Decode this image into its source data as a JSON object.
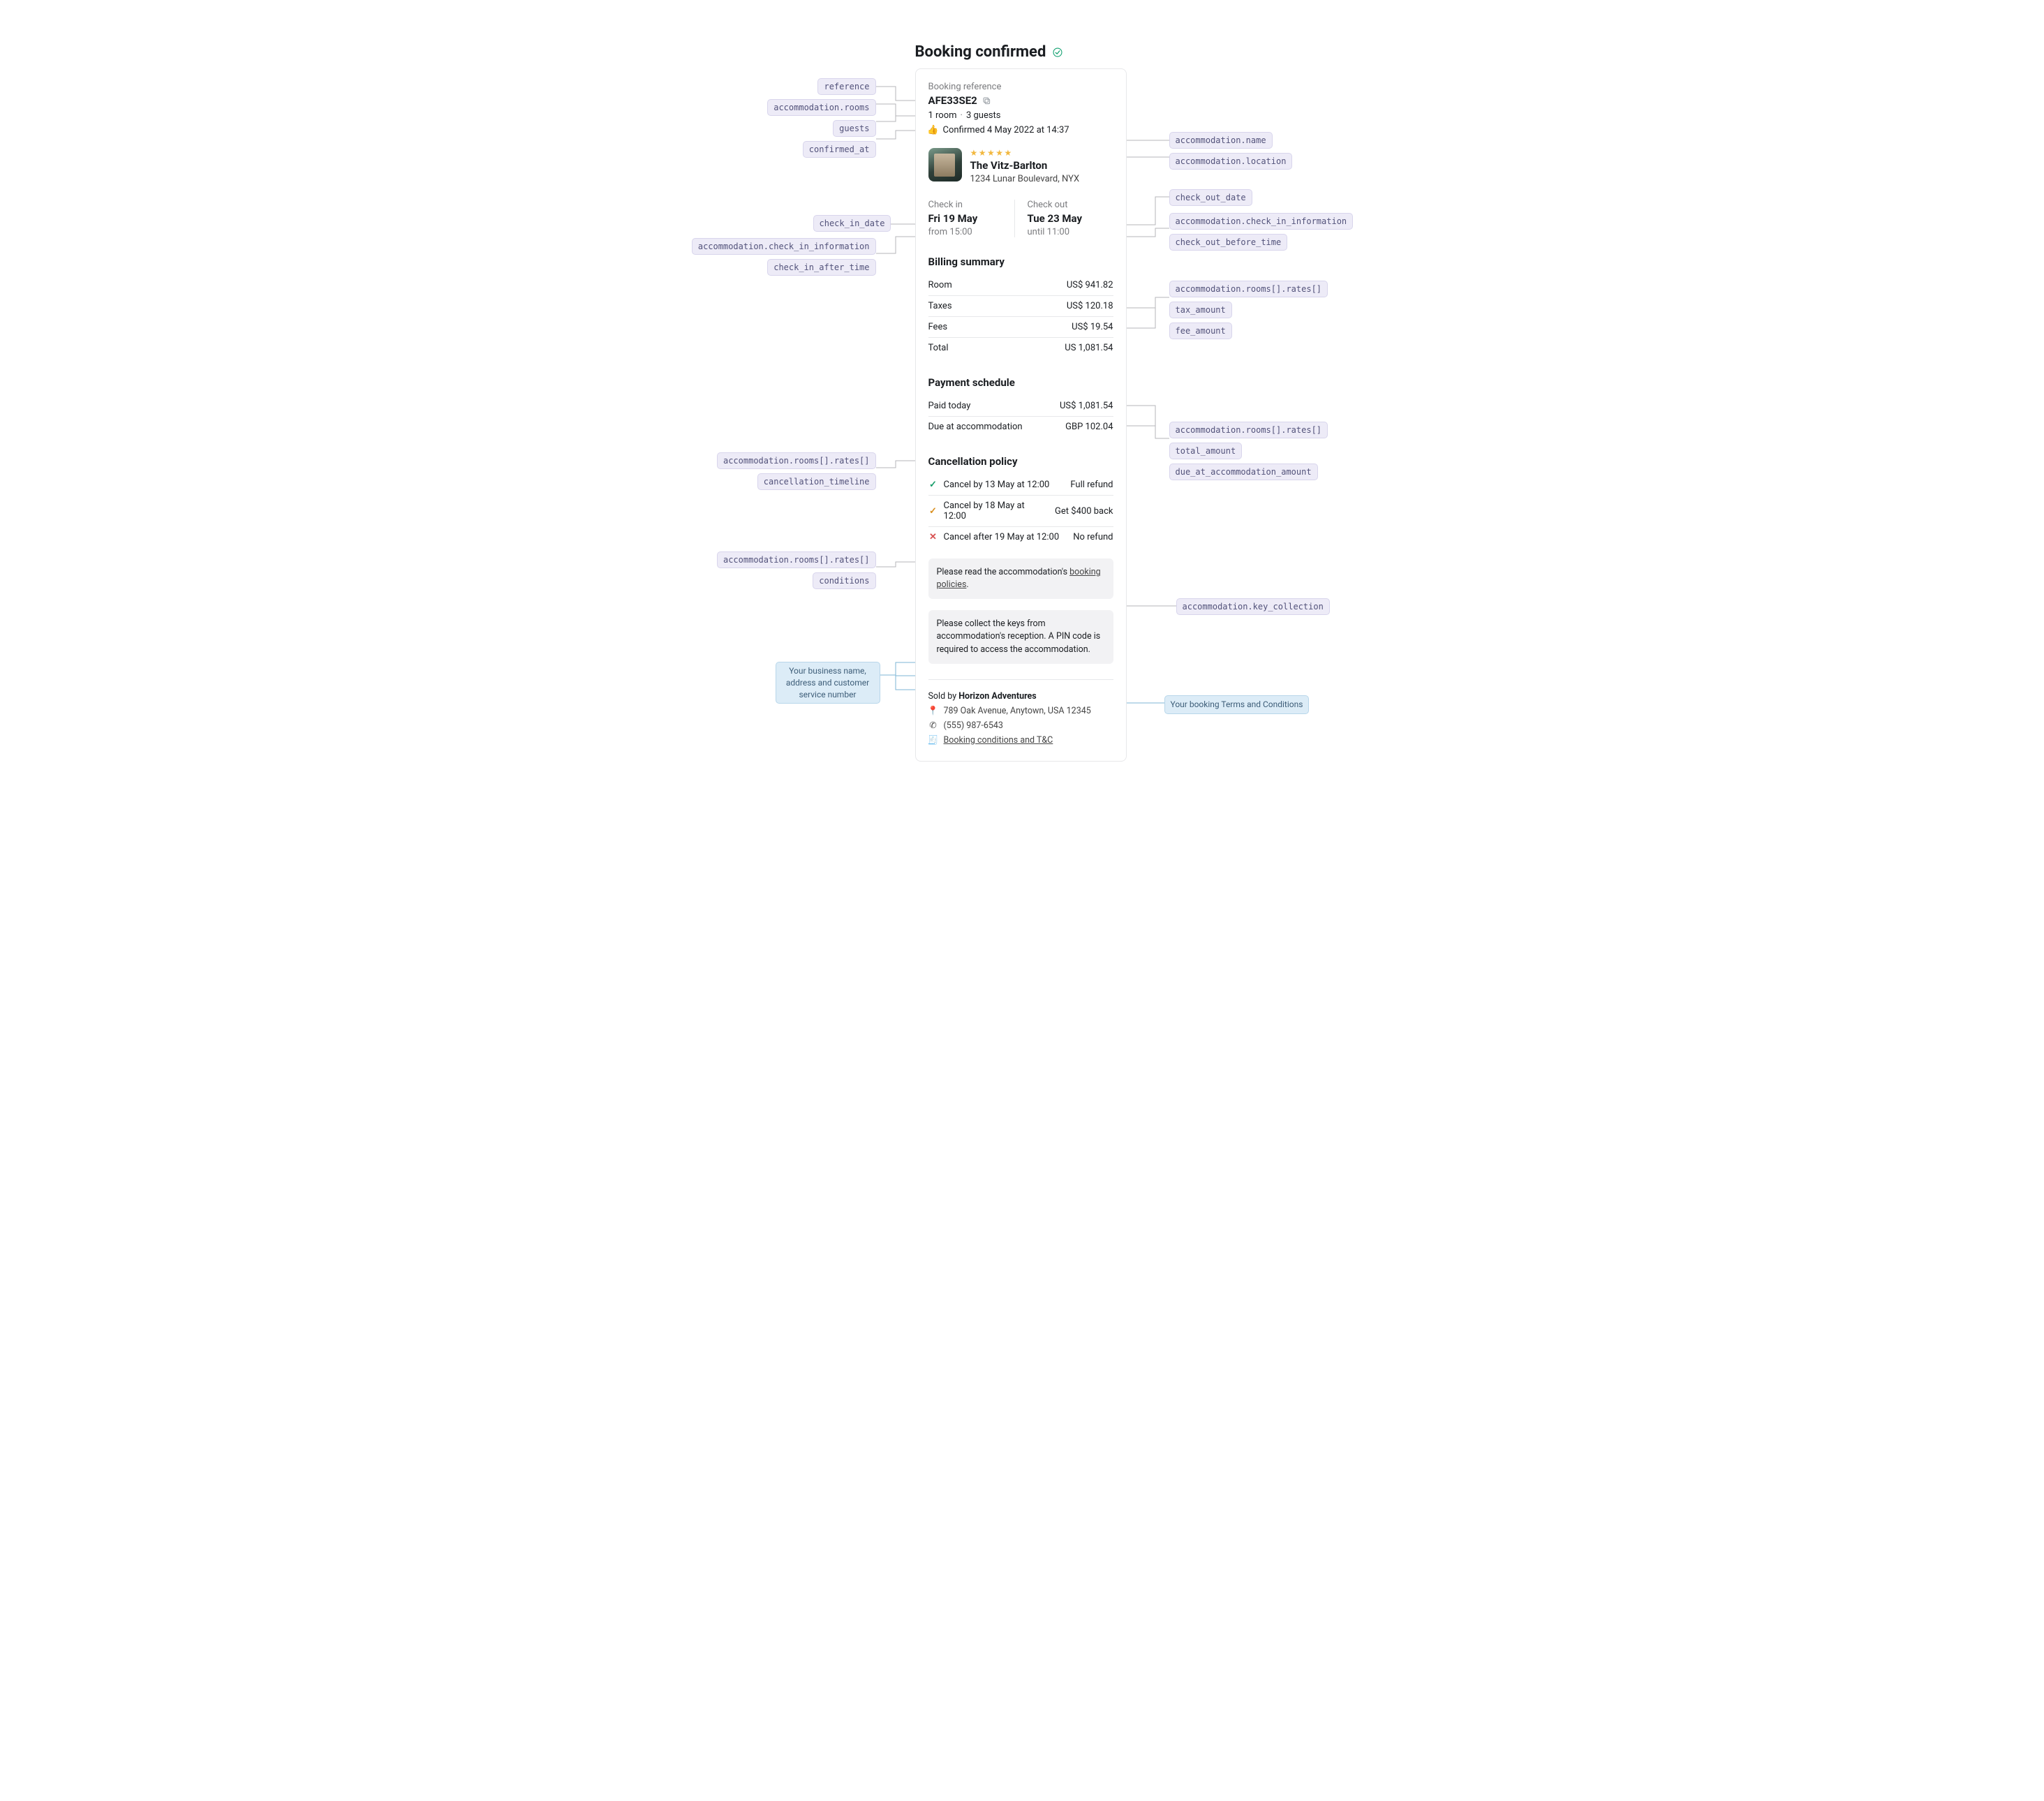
{
  "header": {
    "title": "Booking confirmed"
  },
  "labels": {
    "booking_reference": "Booking reference",
    "check_in": "Check in",
    "check_out": "Check out",
    "billing_summary": "Billing summary",
    "payment_schedule": "Payment schedule",
    "cancellation_policy": "Cancellation policy",
    "room": "Room",
    "taxes": "Taxes",
    "fees": "Fees",
    "total": "Total",
    "paid_today": "Paid today",
    "due_at_accommodation": "Due at accommodation",
    "sold_by": "Sold by"
  },
  "reference": "AFE33SE2",
  "guests": {
    "room_text": "1 room",
    "guest_text": "3 guests"
  },
  "confirmed_at": "Confirmed 4 May 2022 at 14:37",
  "accommodation": {
    "rating": "★★★★★",
    "name": "The Vitz-Barlton",
    "location": "1234 Lunar Boulevard, NYX",
    "check_in_date": "Fri 19 May",
    "check_in_time": "from 15:00",
    "check_out_date": "Tue 23 May",
    "check_out_time": "until 11:00",
    "key_collection": "Please collect the keys from accommodation's reception. A PIN code is required to access the accommodation."
  },
  "billing": {
    "room": "US$ 941.82",
    "taxes": "US$ 120.18",
    "fees": "US$ 19.54",
    "total": "US 1,081.54"
  },
  "payment": {
    "paid_today": "US$ 1,081.54",
    "due_at_accommodation": "GBP 102.04"
  },
  "cancellation": [
    {
      "glyph": "✓",
      "glyph_color": "var(--green)",
      "label": "Cancel by 13 May at 12:00",
      "value": "Full refund"
    },
    {
      "glyph": "✓",
      "glyph_color": "var(--orange)",
      "label": "Cancel by 18 May at 12:00",
      "value": "Get $400 back"
    },
    {
      "glyph": "✕",
      "glyph_color": "var(--red)",
      "label": "Cancel after 19 May at 12:00",
      "value": "No refund"
    }
  ],
  "conditions": {
    "prefix": "Please read the accommodation's ",
    "link": "booking policies"
  },
  "seller": {
    "name": "Horizon Adventures",
    "address": "789 Oak Avenue, Anytown, USA 12345",
    "phone": "(555) 987-6543",
    "tnc": "Booking conditions and T&C"
  },
  "annotations": {
    "reference": "reference",
    "rooms": "accommodation.rooms",
    "guests": "guests",
    "confirmed_at": "confirmed_at",
    "acc_name": "accommodation.name",
    "acc_loc": "accommodation.location",
    "check_out_date": "check_out_date",
    "check_in_date": "check_in_date",
    "cii": "accommodation.check_in_information",
    "ci_after": "check_in_after_time",
    "co_before": "check_out_before_time",
    "rates": "accommodation.rooms[].rates[]",
    "tax_amount": "tax_amount",
    "fee_amount": "fee_amount",
    "total_amount": "total_amount",
    "due_amount": "due_at_accommodation_amount",
    "cancel_timeline": "cancellation_timeline",
    "conditions": "conditions",
    "key_collection": "accommodation.key_collection",
    "biz_callout": "Your business name, address and customer service number",
    "tnc_callout": "Your booking Terms and Conditions"
  }
}
